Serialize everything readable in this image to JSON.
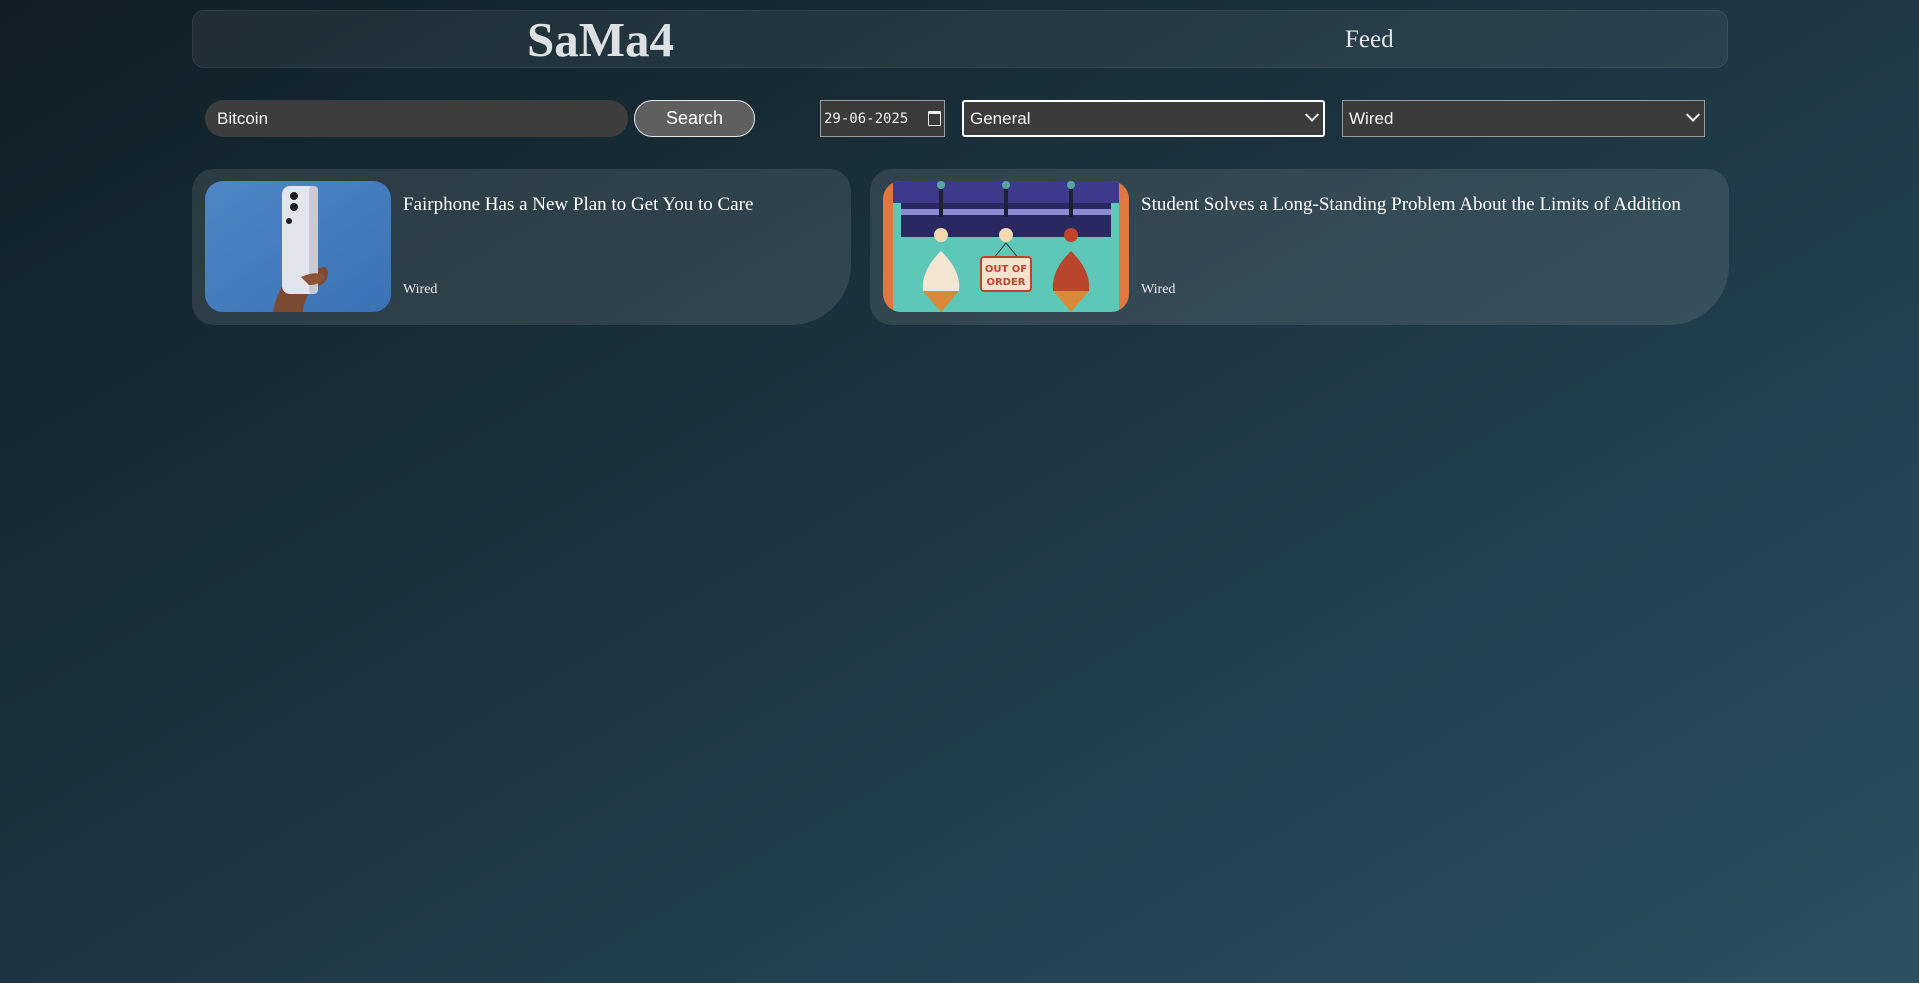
{
  "header": {
    "logo": "SaMa4",
    "nav_feed": "Feed"
  },
  "search": {
    "value": "Bitcoin",
    "button_label": "Search"
  },
  "filters": {
    "date": "29-06-2025",
    "category_selected": "General",
    "source_selected": "Wired"
  },
  "articles": [
    {
      "title": "Fairphone Has a New Plan to Get You to Care",
      "source": "Wired",
      "image": "phone-in-hand-photo"
    },
    {
      "title": "Student Solves a Long-Standing Problem About the Limits of Addition",
      "source": "Wired",
      "image": "ice-cream-machine-out-of-order-illustration",
      "image_text": "OUT OF ORDER"
    }
  ],
  "colors": {
    "background_start": "#0f1e24",
    "background_end": "#2a5062",
    "input_bg": "#3d3d3d",
    "button_bg": "#5f5f5f"
  }
}
